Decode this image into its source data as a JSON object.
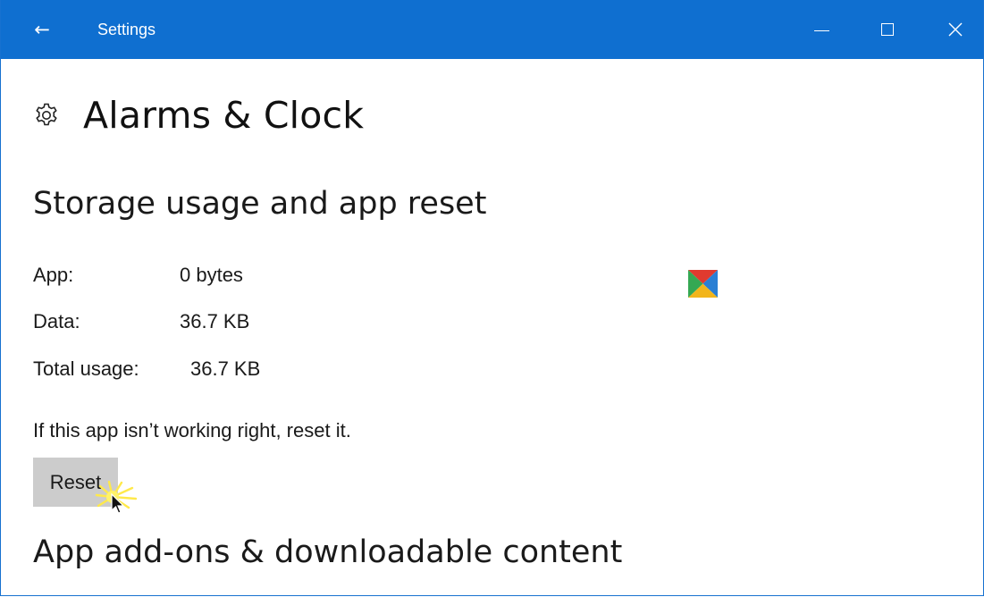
{
  "window": {
    "title": "Settings",
    "back_icon": "arrow-left-icon",
    "controls": [
      "minimize-icon",
      "maximize-icon",
      "close-icon"
    ],
    "accent_color": "#0f6fd0"
  },
  "page": {
    "icon": "gear-icon",
    "title": "Alarms & Clock"
  },
  "storage": {
    "section_title": "Storage usage and app reset",
    "rows": [
      {
        "label": "App:",
        "value": "0 bytes"
      },
      {
        "label": "Data:",
        "value": "36.7 KB"
      },
      {
        "label": "Total usage:",
        "value": "36.7 KB"
      }
    ],
    "hint": "If this app isn’t working right, reset it.",
    "reset_label": "Reset",
    "reset_button_color": "#cccccc"
  },
  "addons": {
    "section_title": "App add-ons & downloadable content"
  },
  "glyphs": {
    "back": "←",
    "close": "✕"
  }
}
